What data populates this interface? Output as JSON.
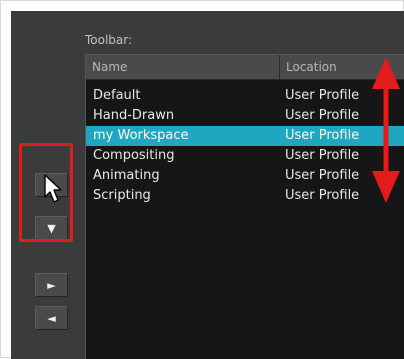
{
  "toolbar_label": "Toolbar:",
  "columns": {
    "name": "Name",
    "location": "Location"
  },
  "rows": [
    {
      "name": "Default",
      "location": "User Profile",
      "selected": false
    },
    {
      "name": "Hand-Drawn",
      "location": "User Profile",
      "selected": false
    },
    {
      "name": "my Workspace",
      "location": "User Profile",
      "selected": true
    },
    {
      "name": "Compositing",
      "location": "User Profile",
      "selected": false
    },
    {
      "name": "Animating",
      "location": "User Profile",
      "selected": false
    },
    {
      "name": "Scripting",
      "location": "User Profile",
      "selected": false
    }
  ],
  "buttons": {
    "move_up": "▲",
    "move_down": "▼",
    "move_right": "►",
    "move_left": "◄"
  },
  "colors": {
    "panel_bg": "#3b3b3b",
    "list_bg": "#161616",
    "selection": "#1fa6c1",
    "annotation_red": "#e21b1b"
  },
  "icons": {
    "cursor": "mouse-pointer-icon",
    "annotation": "double-headed-vertical-arrow"
  }
}
